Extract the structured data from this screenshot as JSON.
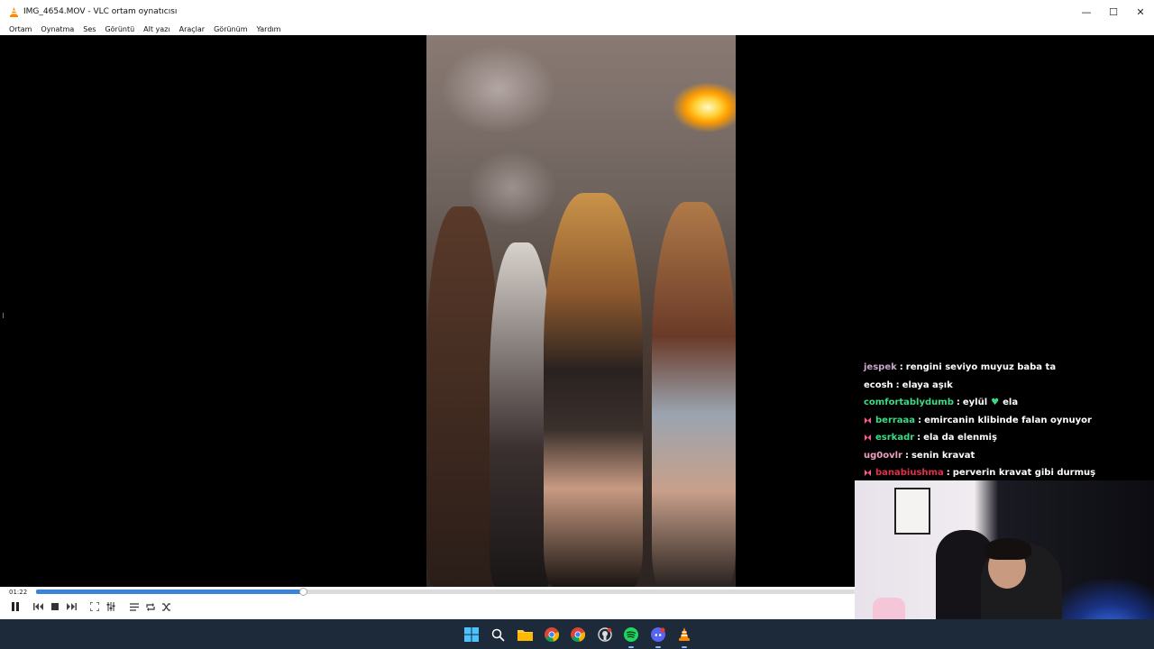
{
  "window": {
    "title": "IMG_4654.MOV - VLC ortam oynatıcısı",
    "minimize_glyph": "—",
    "maximize_glyph": "☐",
    "close_glyph": "✕"
  },
  "menu": [
    "Ortam",
    "Oynatma",
    "Ses",
    "Görüntü",
    "Alt yazı",
    "Araçlar",
    "Görünüm",
    "Yardım"
  ],
  "player": {
    "elapsed": "01:22",
    "progress_fraction": 0.326
  },
  "chat": [
    {
      "user": "jespek",
      "user_color": "#c9a6c9",
      "message": "rengini seviyo muyuz baba ta",
      "badge": false
    },
    {
      "user": "ecosh",
      "user_color": "#ffffff",
      "message": "elaya aşık",
      "badge": false
    },
    {
      "user": "comfortablydumb",
      "user_color": "#3ddc84",
      "message_before": "eylül",
      "message_after": "ela",
      "heart": true,
      "badge": false
    },
    {
      "user": "berraaa",
      "user_color": "#3ddc84",
      "message": "emircanin klibinde falan oynuyor",
      "badge": true
    },
    {
      "user": "esrkadr",
      "user_color": "#3ddc84",
      "message": "ela da elenmiş",
      "badge": true
    },
    {
      "user": "ug0ovlr",
      "user_color": "#f0a0c0",
      "message": "senin kravat",
      "badge": false
    },
    {
      "user": "banabiushma",
      "user_color": "#e0304a",
      "message": "perverin kravat gibi durmuş",
      "badge": true
    }
  ],
  "colors": {
    "seek_fill": "#3a83d6",
    "taskbar_bg": "#1d2a3a",
    "accent_green": "#3ddc84"
  },
  "taskbar_icons": [
    "windows-start-icon",
    "search-icon",
    "file-explorer-icon",
    "chrome-icon",
    "chrome-profile-icon",
    "github-icon",
    "spotify-icon",
    "discord-icon",
    "vlc-icon"
  ]
}
